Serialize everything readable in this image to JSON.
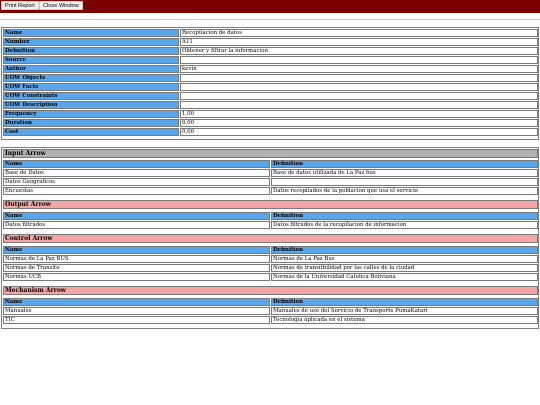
{
  "toolbar": {
    "print_label": "Print Report",
    "close_label": "Close Window"
  },
  "details": [
    {
      "key": "Name",
      "value": "Recopilacion de datos"
    },
    {
      "key": "Number",
      "value": "A11"
    },
    {
      "key": "Definition",
      "value": "Obtener y filtrar la informacion"
    },
    {
      "key": "Source",
      "value": ""
    },
    {
      "key": "Author",
      "value": "kevin"
    },
    {
      "key": "UOW Objects",
      "value": ""
    },
    {
      "key": "UOW Facts",
      "value": ""
    },
    {
      "key": "UOW Constraints",
      "value": ""
    },
    {
      "key": "UOW Description",
      "value": ""
    },
    {
      "key": "Frequency",
      "value": "1,00"
    },
    {
      "key": "Duration",
      "value": "0,00"
    },
    {
      "key": "Cost",
      "value": "0,00"
    }
  ],
  "column_headers": {
    "name": "Name",
    "definition": "Definition"
  },
  "sections": [
    {
      "title": "Input Arrow",
      "color": "#b0b0b0",
      "rows": [
        [
          "Base de Datos",
          "Base de datos utilizada de La Paz bus"
        ],
        [
          "Datos Geograficos",
          ""
        ],
        [
          "Encuestas",
          "Datos recopilados de la poblacion que usa el servicio"
        ]
      ]
    },
    {
      "title": "Output Arrow",
      "color": "#f4a6a6",
      "rows": [
        [
          "Datos filtrados",
          "Datos filtrados de la recopilacion de informacion"
        ]
      ]
    },
    {
      "title": "Control Arrow",
      "color": "#f4a6a6",
      "rows": [
        [
          "Normas de La Paz BUS",
          "Normas de La Paz Bus"
        ],
        [
          "Normas de Transito",
          "Normas de transitbilidad por las  calles de la ciudad"
        ],
        [
          "Normas UCB",
          "Normas de la Universidad Catolica Boliviana"
        ]
      ]
    },
    {
      "title": "Mechanism Arrow",
      "color": "#f4a6a6",
      "rows": [
        [
          "Manuales",
          "Manuales de uso del Servicio de Transporte PumaKatari"
        ],
        [
          "TIC",
          "Tecnologia aplicada en el sistema"
        ]
      ]
    }
  ]
}
